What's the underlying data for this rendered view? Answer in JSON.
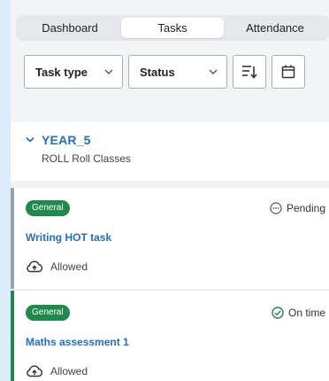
{
  "tabs": [
    {
      "label": "Dashboard",
      "active": false
    },
    {
      "label": "Tasks",
      "active": true
    },
    {
      "label": "Attendance",
      "active": false
    }
  ],
  "filters": {
    "task_type": "Task type",
    "status": "Status",
    "sort_icon": "sort-icon",
    "calendar_icon": "calendar-icon"
  },
  "group": {
    "title": "YEAR_5",
    "subtitle": "ROLL Roll Classes"
  },
  "tasks": [
    {
      "badge": "General",
      "status": "Pending",
      "status_icon": "pending-icon",
      "title": "Writing HOT task",
      "submission": "Allowed",
      "accent": "#9aa3ad"
    },
    {
      "badge": "General",
      "status": "On time",
      "status_icon": "check-circle-icon",
      "title": "Maths assessment 1",
      "submission": "Allowed",
      "accent": "#1e8a4c"
    }
  ],
  "colors": {
    "background": "#dbecfb",
    "link": "#1f6fc5",
    "badge": "#1e8a4c"
  }
}
